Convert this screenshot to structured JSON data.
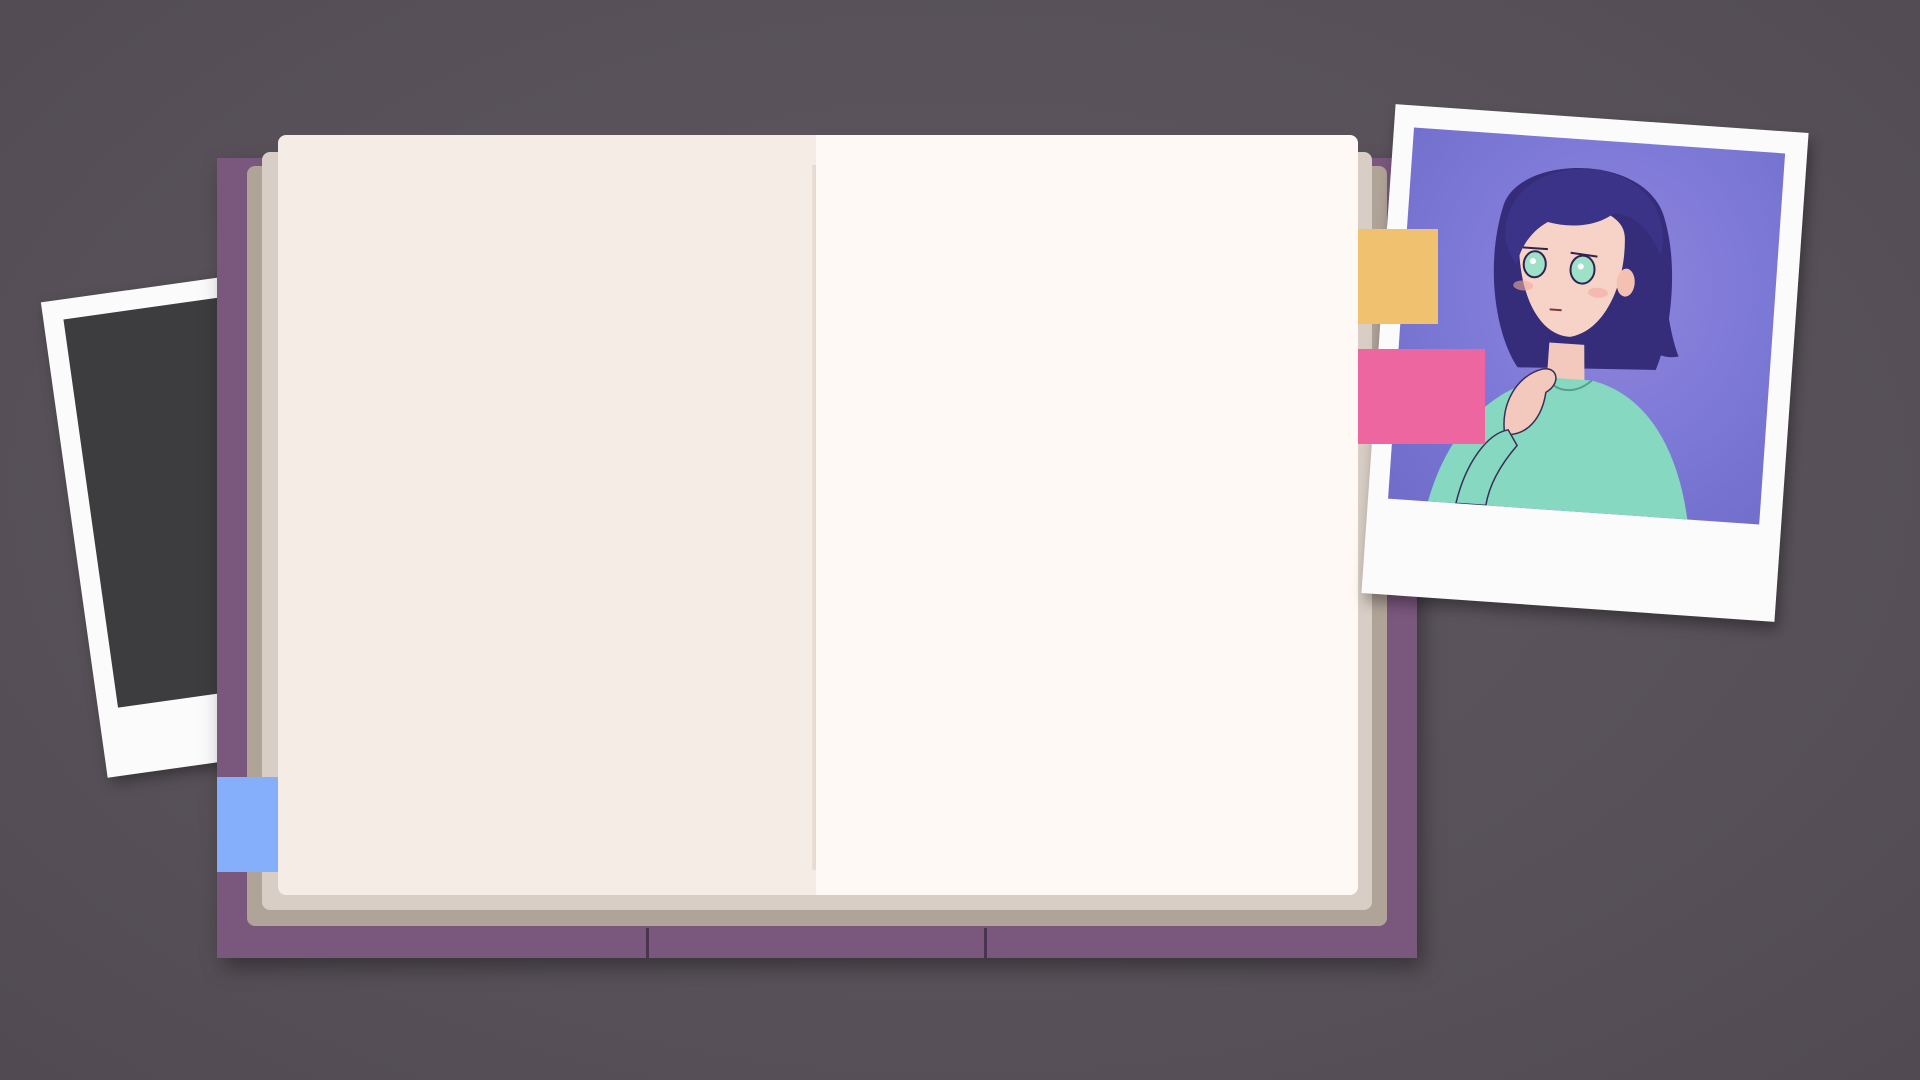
{
  "scene": {
    "description_colors": {
      "background": "#58515a",
      "notebook_cover": "#7a577d",
      "page_left": "#f5ece6",
      "page_right": "#fef9f5",
      "tab_yellow": "#f0c26f",
      "tab_pink": "#ee66a0",
      "tab_blue": "#85affa"
    }
  },
  "icons": {
    "left_photo": "blank-polaroid",
    "right_photo": "character-portrait-polaroid"
  }
}
